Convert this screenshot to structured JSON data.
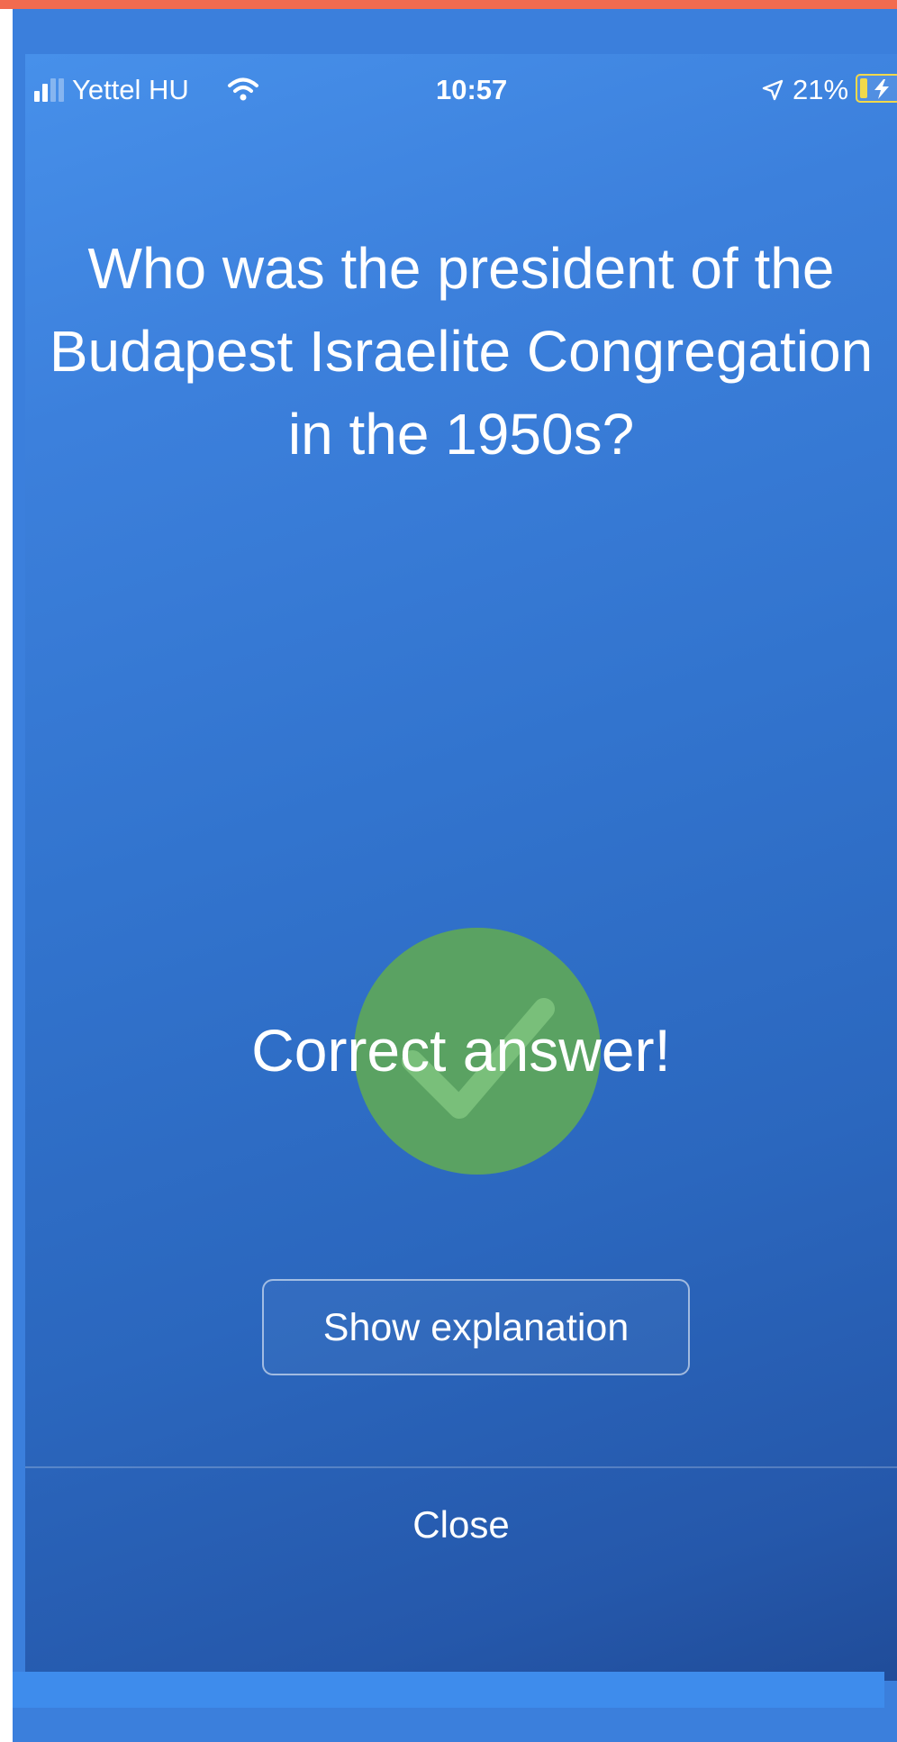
{
  "status_bar": {
    "carrier": "Yettel HU",
    "time": "10:57",
    "battery_percent": "21%",
    "battery_level": 0.21,
    "icons": {
      "signal": "signal-bars-icon",
      "wifi": "wifi-icon",
      "location": "location-arrow-icon",
      "battery": "battery-charging-icon"
    }
  },
  "quiz": {
    "question": "Who was the president of the Budapest Israelite Congregation in the 1950s?",
    "result_text": "Correct answer!",
    "result_icon": "checkmark-icon",
    "show_explanation_label": "Show explanation",
    "close_label": "Close"
  },
  "colors": {
    "accent_top": "#f26b4f",
    "success_green": "#5aa262",
    "background_blue": "#3b7fdc",
    "battery_yellow": "#f2d94a"
  }
}
